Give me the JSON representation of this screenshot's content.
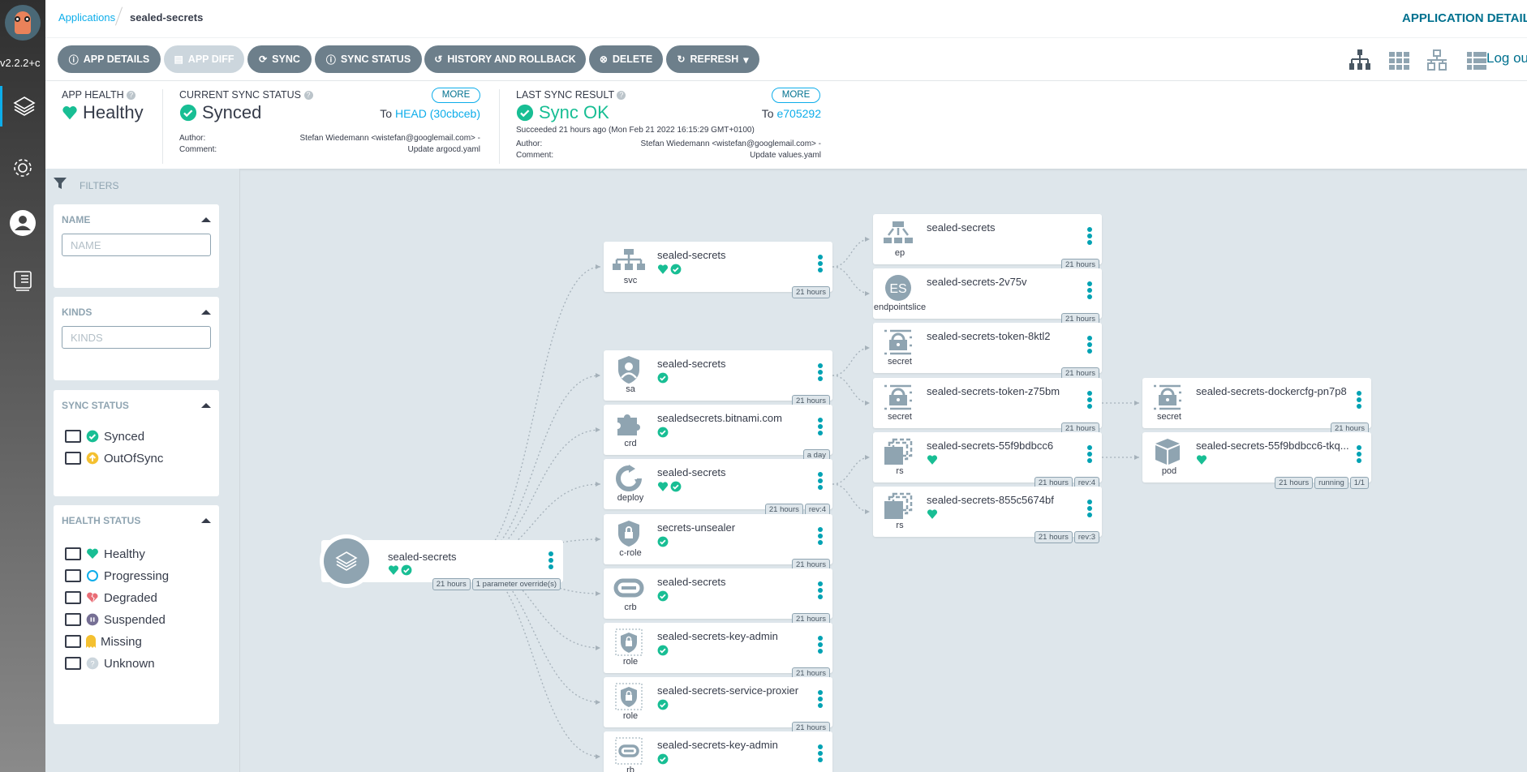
{
  "sidebar": {
    "version": "v2.2.2+c",
    "items": [
      {
        "icon": "layers-icon"
      },
      {
        "icon": "gear-icon"
      },
      {
        "icon": "user-icon"
      },
      {
        "icon": "docs-icon"
      }
    ]
  },
  "header": {
    "breadcrumb": [
      "Applications",
      "sealed-secrets"
    ],
    "title": "APPLICATION DETAILS"
  },
  "toolbar": {
    "buttons": [
      "APP DETAILS",
      "APP DIFF",
      "SYNC",
      "SYNC STATUS",
      "HISTORY AND ROLLBACK",
      "DELETE",
      "REFRESH"
    ],
    "logout": "Log out",
    "views": [
      "tree-view-icon",
      "pods-view-icon",
      "network-view-icon",
      "list-view-icon"
    ]
  },
  "status": {
    "health": {
      "label": "APP HEALTH",
      "value": "Healthy"
    },
    "sync": {
      "label": "CURRENT SYNC STATUS",
      "value": "Synced",
      "more": "MORE",
      "to_prefix": "To",
      "to": "HEAD (30cbceb)",
      "author_label": "Author:",
      "author": "Stefan Wiedemann <wistefan@googlemail.com> -",
      "comment_label": "Comment:",
      "comment": "Update argocd.yaml"
    },
    "last": {
      "label": "LAST SYNC RESULT",
      "value": "Sync OK",
      "more": "MORE",
      "to_prefix": "To",
      "to": "e705292",
      "succeeded": "Succeeded 21 hours ago (Mon Feb 21 2022 16:15:29 GMT+0100)",
      "author_label": "Author:",
      "author": "Stefan Wiedemann <wistefan@googlemail.com> -",
      "comment_label": "Comment:",
      "comment": "Update values.yaml"
    }
  },
  "filters": {
    "title": "FILTERS",
    "name": {
      "title": "NAME",
      "placeholder": "NAME"
    },
    "kinds": {
      "title": "KINDS",
      "placeholder": "KINDS"
    },
    "sync": {
      "title": "SYNC STATUS",
      "options": [
        "Synced",
        "OutOfSync"
      ]
    },
    "health": {
      "title": "HEALTH STATUS",
      "options": [
        "Healthy",
        "Progressing",
        "Degraded",
        "Suspended",
        "Missing",
        "Unknown"
      ]
    }
  },
  "colors": {
    "healthy": "#18be94",
    "accent": "#0dadea",
    "button": "#6d7f8b",
    "outofsync": "#f4c030",
    "degraded": "#e96d76",
    "suspended": "#766f94",
    "missing": "#f4c030",
    "unknown": "#ccd6dd",
    "progressing": "#0dadea"
  },
  "graph": {
    "root": {
      "name": "sealed-secrets",
      "health": true,
      "sync": true,
      "badges": [
        "21 hours",
        "1 parameter override(s)"
      ]
    },
    "nodes": [
      {
        "kind": "svc",
        "name": "sealed-secrets",
        "health": true,
        "sync": true,
        "badges": [
          "21 hours"
        ]
      },
      {
        "kind": "sa",
        "name": "sealed-secrets",
        "health": false,
        "sync": true,
        "badges": [
          "21 hours"
        ]
      },
      {
        "kind": "crd",
        "name": "sealedsecrets.bitnami.com",
        "health": false,
        "sync": true,
        "badges": [
          "a day"
        ]
      },
      {
        "kind": "deploy",
        "name": "sealed-secrets",
        "health": true,
        "sync": true,
        "badges": [
          "21 hours",
          "rev:4"
        ]
      },
      {
        "kind": "c-role",
        "name": "secrets-unsealer",
        "health": false,
        "sync": true,
        "badges": [
          "21 hours"
        ]
      },
      {
        "kind": "crb",
        "name": "sealed-secrets",
        "health": false,
        "sync": true,
        "badges": [
          "21 hours"
        ]
      },
      {
        "kind": "role",
        "name": "sealed-secrets-key-admin",
        "health": false,
        "sync": true,
        "badges": [
          "21 hours"
        ]
      },
      {
        "kind": "role",
        "name": "sealed-secrets-service-proxier",
        "health": false,
        "sync": true,
        "badges": [
          "21 hours"
        ]
      },
      {
        "kind": "rb",
        "name": "sealed-secrets-key-admin",
        "health": false,
        "sync": true,
        "badges": []
      },
      {
        "kind": "ep",
        "name": "sealed-secrets",
        "health": false,
        "sync": false,
        "badges": [
          "21 hours"
        ]
      },
      {
        "kind": "endpointslice",
        "name": "sealed-secrets-2v75v",
        "health": false,
        "sync": false,
        "badges": [
          "21 hours"
        ]
      },
      {
        "kind": "secret",
        "name": "sealed-secrets-token-8ktl2",
        "health": false,
        "sync": false,
        "badges": [
          "21 hours"
        ]
      },
      {
        "kind": "secret",
        "name": "sealed-secrets-token-z75bm",
        "health": false,
        "sync": false,
        "badges": [
          "21 hours"
        ]
      },
      {
        "kind": "rs",
        "name": "sealed-secrets-55f9bdbcc6",
        "health": true,
        "sync": false,
        "badges": [
          "21 hours",
          "rev:4"
        ]
      },
      {
        "kind": "rs",
        "name": "sealed-secrets-855c5674bf",
        "health": true,
        "sync": false,
        "badges": [
          "21 hours",
          "rev:3"
        ]
      },
      {
        "kind": "secret",
        "name": "sealed-secrets-dockercfg-pn7p8",
        "health": false,
        "sync": false,
        "badges": [
          "21 hours"
        ]
      },
      {
        "kind": "pod",
        "name": "sealed-secrets-55f9bdbcc6-tkq...",
        "health": true,
        "sync": false,
        "badges": [
          "21 hours",
          "running",
          "1/1"
        ]
      }
    ]
  }
}
